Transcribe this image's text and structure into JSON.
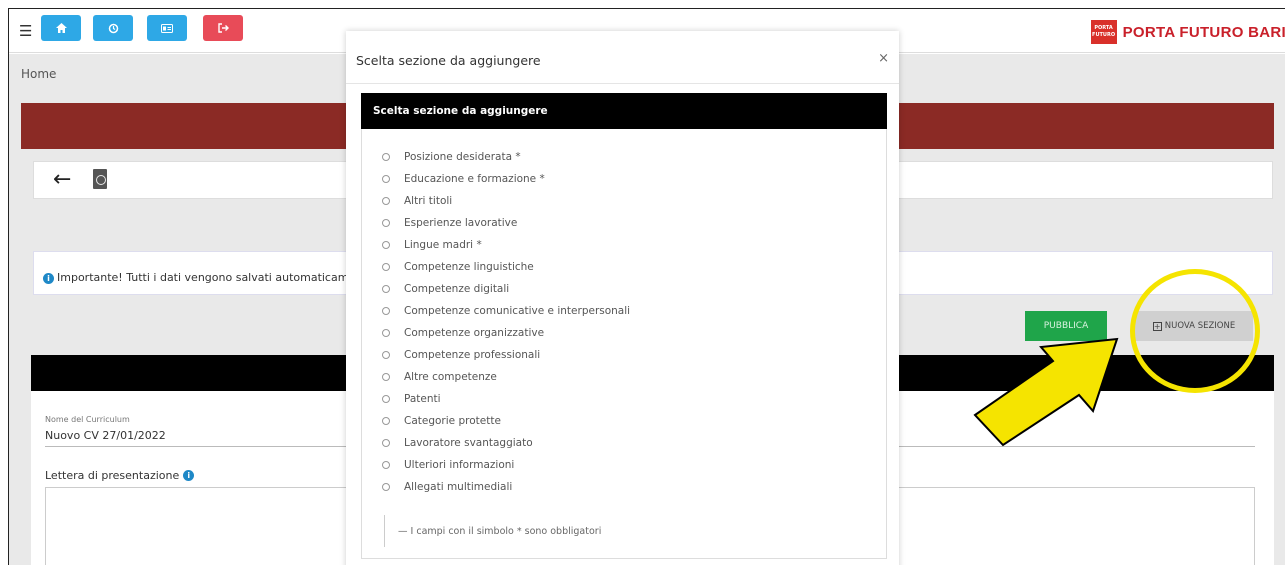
{
  "topbar": {
    "buttons": [
      {
        "name": "home",
        "color": "#2ea8e6"
      },
      {
        "name": "history",
        "color": "#2ea8e6"
      },
      {
        "name": "id-card",
        "color": "#2ea8e6"
      },
      {
        "name": "logout",
        "color": "#e84b58"
      }
    ],
    "brand": {
      "name": "PORTA FUTURO BARI",
      "logo_text": "PORTA FUTURO",
      "accent": "#c9202a"
    }
  },
  "breadcrumb": "Home",
  "alert": {
    "text": "Importante! Tutti i dati vengono salvati automaticamente in boz"
  },
  "actions": {
    "publish": "PUBBLICA",
    "new_section": "NUOVA SEZIONE"
  },
  "form": {
    "cv_name_label": "Nome del Curriculum",
    "cv_name_value": "Nuovo CV 27/01/2022",
    "cover_letter_label": "Lettera di presentazione"
  },
  "modal": {
    "title": "Scelta sezione da aggiungere",
    "close": "×",
    "section_header": "Scelta sezione da aggiungere",
    "options": [
      "Posizione desiderata *",
      "Educazione e formazione *",
      "Altri titoli",
      "Esperienze lavorative",
      "Lingue madri *",
      "Competenze linguistiche",
      "Competenze digitali",
      "Competenze comunicative e interpersonali",
      "Competenze organizzative",
      "Competenze professionali",
      "Altre competenze",
      "Patenti",
      "Categorie protette",
      "Lavoratore svantaggiato",
      "Ulteriori informazioni",
      "Allegati multimediali"
    ],
    "required_note": "— I campi con il simbolo * sono obbligatori"
  },
  "annotation_colors": {
    "highlight": "#f5e400",
    "arrow_outline": "#000000"
  }
}
